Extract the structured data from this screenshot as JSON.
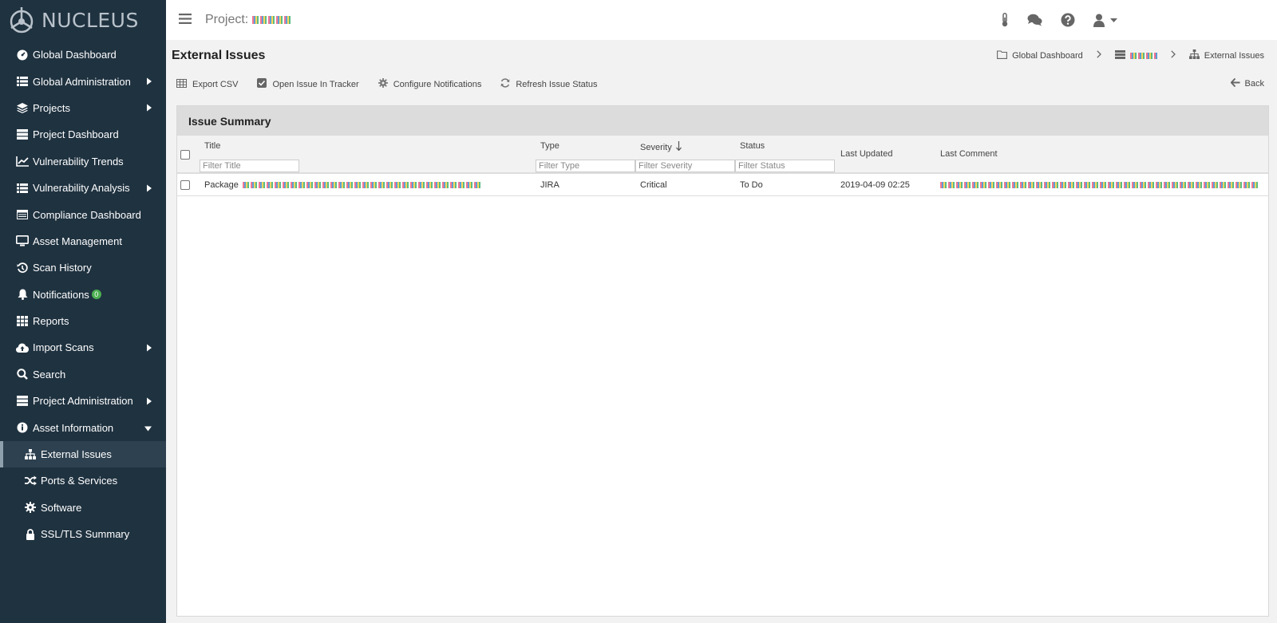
{
  "app": {
    "logo_text": "NUCLEUS"
  },
  "sidebar": {
    "items": [
      {
        "label": "Global Dashboard",
        "icon": "dashboard-icon"
      },
      {
        "label": "Global Administration",
        "icon": "list-icon"
      },
      {
        "label": "Projects",
        "icon": "layers-icon"
      },
      {
        "label": "Project Dashboard",
        "icon": "server-icon"
      },
      {
        "label": "Vulnerability Trends",
        "icon": "line-chart-icon"
      },
      {
        "label": "Vulnerability Analysis",
        "icon": "list-icon"
      },
      {
        "label": "Compliance Dashboard",
        "icon": "table-icon"
      },
      {
        "label": "Asset Management",
        "icon": "desktop-icon"
      },
      {
        "label": "Scan History",
        "icon": "history-icon"
      },
      {
        "label": "Notifications",
        "icon": "bell-icon",
        "badge": "0"
      },
      {
        "label": "Reports",
        "icon": "grid-icon"
      },
      {
        "label": "Import Scans",
        "icon": "cloud-upload-icon"
      },
      {
        "label": "Search",
        "icon": "search-icon"
      },
      {
        "label": "Project Administration",
        "icon": "server-icon"
      },
      {
        "label": "Asset Information",
        "icon": "info-icon"
      },
      {
        "label": "External Issues",
        "icon": "sitemap-icon"
      },
      {
        "label": "Ports & Services",
        "icon": "random-icon"
      },
      {
        "label": "Software",
        "icon": "gear-icon"
      },
      {
        "label": "SSL/TLS Summary",
        "icon": "lock-icon"
      }
    ]
  },
  "topbar": {
    "project_label": "Project:"
  },
  "page": {
    "title": "External Issues"
  },
  "breadcrumb": {
    "home": "Global Dashboard",
    "current": "External Issues"
  },
  "toolbar": {
    "export_csv": "Export CSV",
    "open_issue": "Open Issue In Tracker",
    "configure_notifications": "Configure Notifications",
    "refresh_status": "Refresh Issue Status",
    "back": "Back"
  },
  "panel": {
    "title": "Issue Summary",
    "columns": {
      "title": "Title",
      "type": "Type",
      "severity": "Severity",
      "status": "Status",
      "last_updated": "Last Updated",
      "last_comment": "Last Comment"
    },
    "filters": {
      "title": "Filter Title",
      "type": "Filter Type",
      "severity": "Filter Severity",
      "status": "Filter Status"
    },
    "rows": [
      {
        "title": "Package",
        "type": "JIRA",
        "severity": "Critical",
        "status": "To Do",
        "last_updated": "2019-04-09 02:25"
      }
    ]
  },
  "colors": {
    "sidebar_bg": "#1f3240",
    "active_item_bg": "#2e4150",
    "badge_green": "#4caf50"
  }
}
